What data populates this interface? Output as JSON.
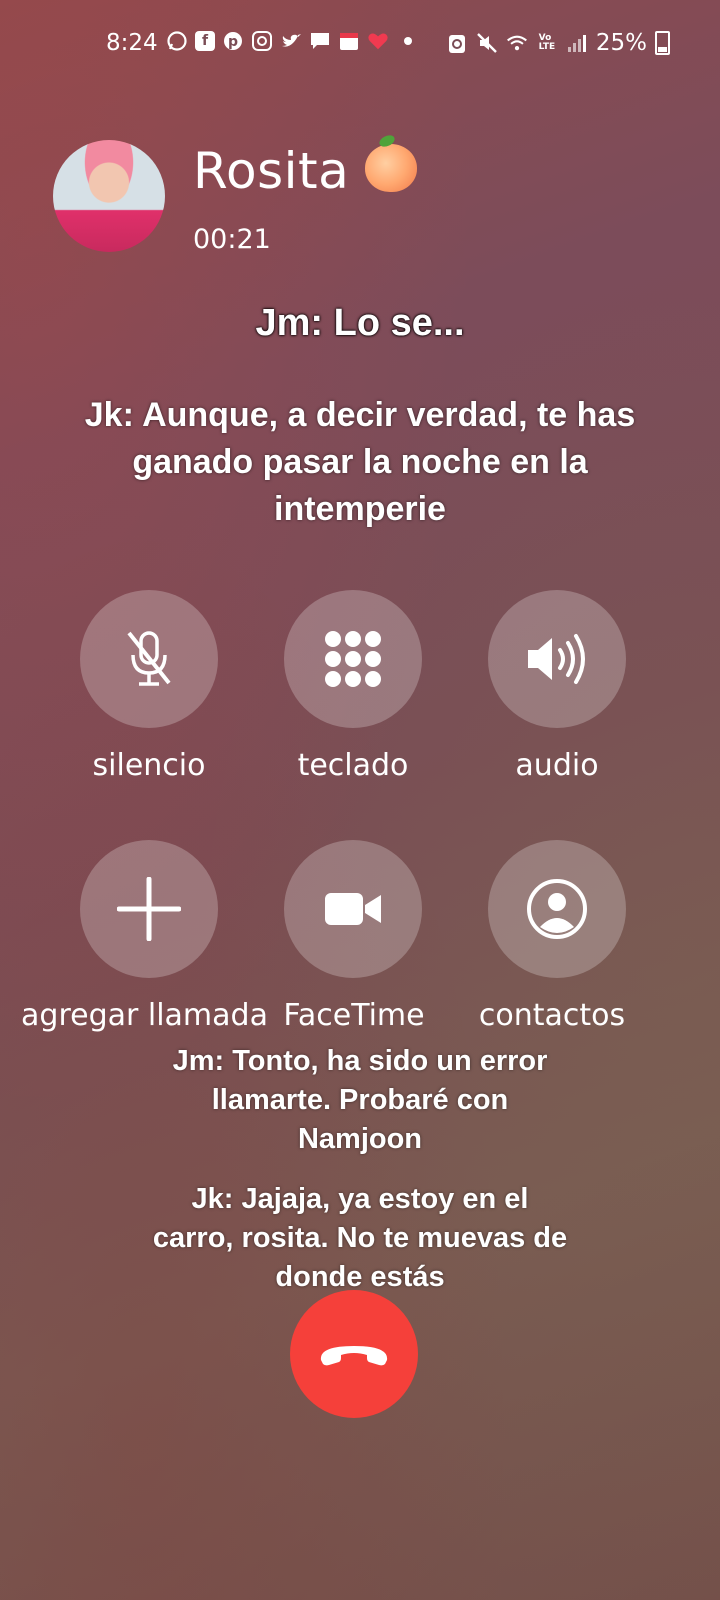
{
  "status_bar": {
    "time": "8:24",
    "battery": "25%",
    "icons": [
      "whatsapp-icon",
      "facebook-icon",
      "pinterest-icon",
      "instagram-icon",
      "twitter-icon",
      "message-icon",
      "calendar-icon",
      "heart-icon",
      "dot-icon",
      "recycle-icon",
      "mute-icon",
      "wifi-icon",
      "volte-icon",
      "signal-icon",
      "battery-icon"
    ]
  },
  "caller": {
    "name": "Rosita",
    "emoji": "peach-emoji",
    "duration": "00:21"
  },
  "subtitles": {
    "line1": "Jm: Lo se...",
    "line2": "Jk: Aunque, a decir verdad, te has ganado pasar la noche en la intemperie",
    "line3": "Jm: Tonto, ha sido un error llamarte. Probaré con Namjoon",
    "line4": "Jk: Jajaja, ya estoy en el carro, rosita. No te muevas de donde estás"
  },
  "controls": {
    "mute": "silencio",
    "keypad": "teclado",
    "audio": "audio",
    "add_call": "agregar llamada",
    "facetime": "FaceTime",
    "contacts": "contactos"
  },
  "colors": {
    "end_call": "#f5403a",
    "button_bg": "rgba(255,255,255,0.24)"
  }
}
